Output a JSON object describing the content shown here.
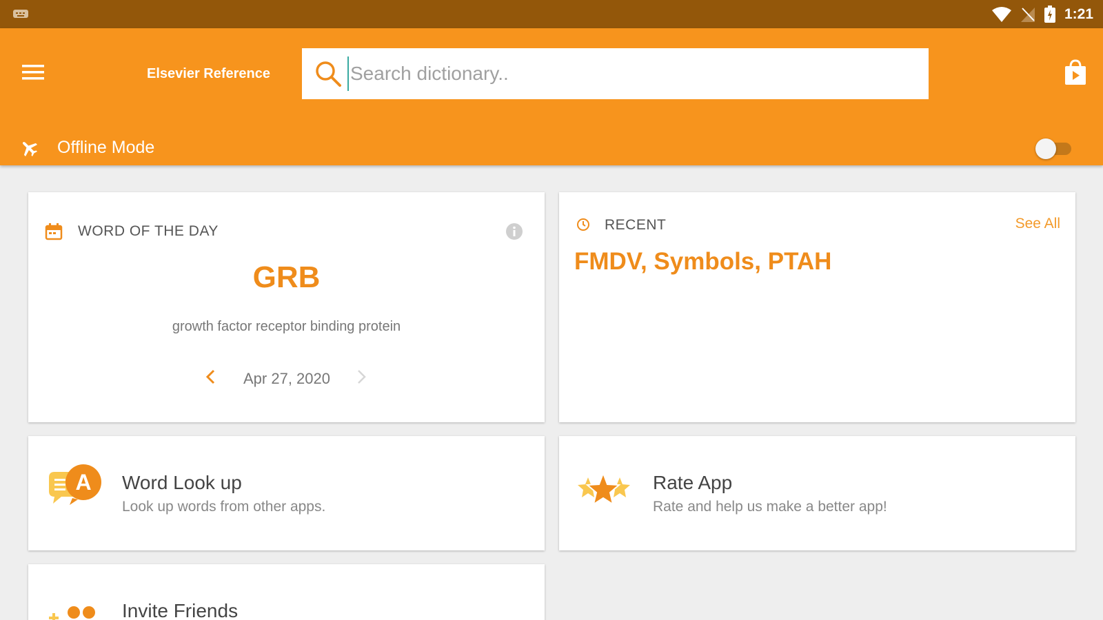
{
  "status_bar": {
    "time": "1:21",
    "icons": [
      "keyboard-icon",
      "wifi-icon",
      "no-signal-icon",
      "battery-icon"
    ]
  },
  "app_bar": {
    "title": "Elsevier Reference",
    "search": {
      "placeholder": "Search dictionary..",
      "value": ""
    },
    "offline_mode": {
      "label": "Offline Mode",
      "enabled": false
    },
    "icons": [
      "menu-icon",
      "search-icon",
      "store-bag-icon",
      "airplane-icon"
    ]
  },
  "word_of_the_day": {
    "label": "WORD OF THE DAY",
    "word": "GRB",
    "definition": "growth factor receptor binding protein",
    "date": "Apr 27, 2020",
    "icons": [
      "calendar-icon",
      "info-icon",
      "chevron-left-icon",
      "chevron-right-icon"
    ]
  },
  "recent": {
    "label": "RECENT",
    "see_all": "See All",
    "words": "FMDV, Symbols, PTAH",
    "icons": [
      "history-icon"
    ]
  },
  "features": {
    "word_lookup": {
      "title": "Word Look up",
      "subtitle": "Look up words from other apps.",
      "icon": "word-lookup-icon"
    },
    "rate_app": {
      "title": "Rate App",
      "subtitle": "Rate and help us make a better app!",
      "icon": "rate-stars-icon"
    },
    "invite_friends": {
      "title": "Invite Friends",
      "icon": "invite-friends-icon"
    }
  },
  "colors": {
    "status_bar": "#93570a",
    "app_bar": "#f7941d",
    "accent": "#ef8c1b",
    "background": "#eeeeee",
    "card": "#ffffff"
  }
}
